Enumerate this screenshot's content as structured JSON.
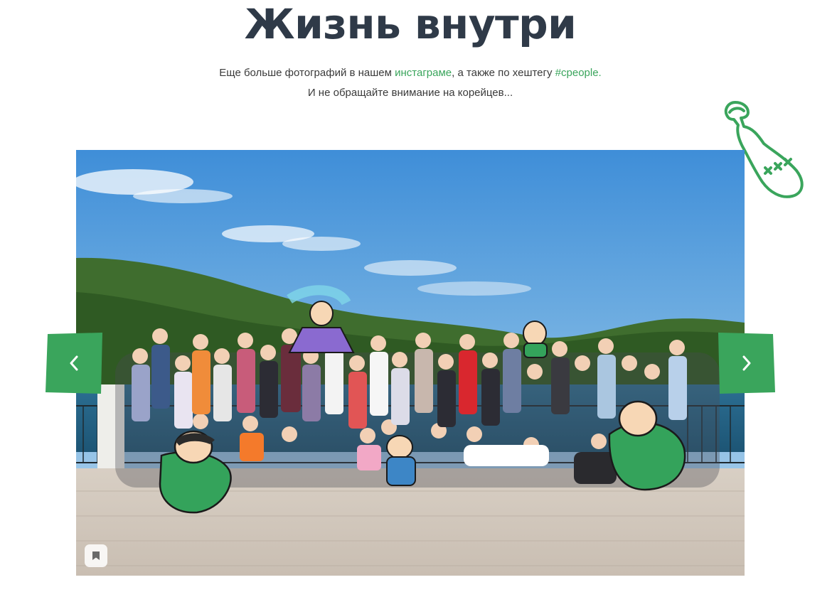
{
  "header": {
    "title": "Жизнь внутри",
    "line1_prefix": "Еще больше фотографий в нашем ",
    "instagram_link": "инстаграме",
    "line1_middle": ", а также по хештегу ",
    "hashtag_link": "#cpeople.",
    "line2": "И не обращайте внимание на корейцев..."
  },
  "slider": {
    "photo_icon": "group-photo",
    "prev_icon": "chevron-left-icon",
    "next_icon": "chevron-right-icon",
    "bookmark_icon": "bookmark-icon"
  },
  "decor": {
    "bottle_label": "XXX"
  },
  "colors": {
    "accent": "#3aa55c",
    "title": "#2f3a48",
    "nav_bg": "#3aa55c"
  }
}
